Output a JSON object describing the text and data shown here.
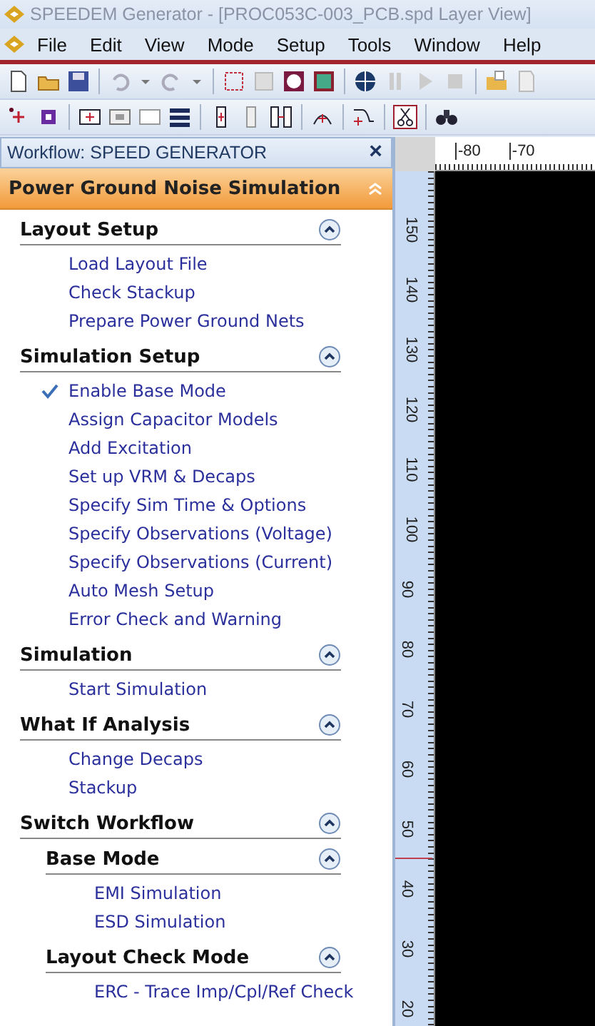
{
  "window": {
    "title": "SPEEDEM Generator - [PROC053C-003_PCB.spd Layer View]"
  },
  "menu": [
    "File",
    "Edit",
    "View",
    "Mode",
    "Setup",
    "Tools",
    "Window",
    "Help"
  ],
  "workflow_panel": {
    "title": "Workflow: SPEED GENERATOR",
    "close": "×",
    "header": "Power Ground Noise Simulation",
    "sections": [
      {
        "title": "Layout Setup",
        "expanded": true,
        "items": [
          {
            "label": "Load Layout File",
            "checked": false
          },
          {
            "label": "Check Stackup",
            "checked": false
          },
          {
            "label": "Prepare Power Ground Nets",
            "checked": false
          }
        ]
      },
      {
        "title": "Simulation Setup",
        "expanded": true,
        "items": [
          {
            "label": "Enable Base Mode",
            "checked": true
          },
          {
            "label": "Assign Capacitor Models",
            "checked": false
          },
          {
            "label": "Add Excitation",
            "checked": false
          },
          {
            "label": "Set up VRM & Decaps",
            "checked": false
          },
          {
            "label": "Specify Sim Time & Options",
            "checked": false
          },
          {
            "label": "Specify Observations (Voltage)",
            "checked": false
          },
          {
            "label": "Specify Observations (Current)",
            "checked": false
          },
          {
            "label": "Auto Mesh Setup",
            "checked": false
          },
          {
            "label": "Error Check and Warning",
            "checked": false
          }
        ]
      },
      {
        "title": "Simulation",
        "expanded": true,
        "items": [
          {
            "label": "Start Simulation",
            "checked": false
          }
        ]
      },
      {
        "title": "What If Analysis",
        "expanded": true,
        "items": [
          {
            "label": "Change Decaps",
            "checked": false
          },
          {
            "label": "Stackup",
            "checked": false
          }
        ]
      },
      {
        "title": "Switch Workflow",
        "expanded": true,
        "children": [
          {
            "title": "Base Mode",
            "expanded": true,
            "items": [
              {
                "label": "EMI Simulation",
                "checked": false
              },
              {
                "label": "ESD Simulation",
                "checked": false
              }
            ]
          },
          {
            "title": "Layout Check Mode",
            "expanded": true,
            "items": [
              {
                "label": "ERC - Trace Imp/Cpl/Ref Check",
                "checked": false
              }
            ]
          }
        ]
      }
    ]
  },
  "rulers": {
    "horizontal_labels": [
      "-80",
      "-70"
    ],
    "vertical_labels": [
      "150",
      "140",
      "130",
      "120",
      "110",
      "100",
      "90",
      "80",
      "70",
      "60",
      "50",
      "40",
      "30",
      "20"
    ]
  }
}
